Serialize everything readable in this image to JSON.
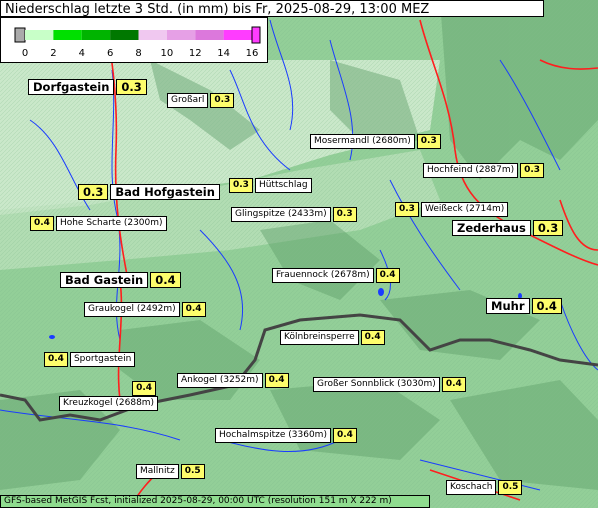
{
  "title": "Niederschlag letzte 3 Std. (in mm) bis Fr, 2025-08-29, 13:00 MEZ",
  "legend": {
    "ticks": [
      "0",
      "2",
      "4",
      "6",
      "8",
      "10",
      "12",
      "14",
      "16"
    ],
    "colors": [
      "#aaaaaa",
      "#c8ffc8",
      "#00e000",
      "#00b400",
      "#007800",
      "#f0c8f0",
      "#e6a0e6",
      "#dc78dc",
      "#ff3cff"
    ]
  },
  "places": [
    {
      "name": "Dorfgastein",
      "value": "0.3",
      "big": true
    },
    {
      "name": "Großarl",
      "value": "0.3"
    },
    {
      "name": "Mosermandl (2680m)",
      "value": "0.3"
    },
    {
      "name": "Hochfeind (2887m)",
      "value": "0.3"
    },
    {
      "name": "Bad Hofgastein",
      "value": "0.3",
      "big": true,
      "valueFirst": true
    },
    {
      "name": "Hüttschlag",
      "value": "0.3",
      "valueFirst": true
    },
    {
      "name": "Weißeck (2714m)",
      "value": "0.3",
      "valueFirst": true
    },
    {
      "name": "Hohe Scharte (2300m)",
      "value": "0.4",
      "valueFirst": true
    },
    {
      "name": "Glingspitze (2433m)",
      "value": "0.3"
    },
    {
      "name": "Zederhaus",
      "value": "0.3",
      "big": true
    },
    {
      "name": "Frauennock (2678m)",
      "value": "0.4"
    },
    {
      "name": "Bad Gastein",
      "value": "0.4",
      "big": true
    },
    {
      "name": "Muhr",
      "value": "0.4",
      "big": true
    },
    {
      "name": "Graukogel (2492m)",
      "value": "0.4"
    },
    {
      "name": "Kölnbreinsperre",
      "value": "0.4"
    },
    {
      "name": "Sportgastein",
      "value": "0.4",
      "valueFirst": true
    },
    {
      "name": "Kreuzkogel (2688m)",
      "value": "0.4",
      "valueAbove": true
    },
    {
      "name": "Ankogel (3252m)",
      "value": "0.4"
    },
    {
      "name": "Großer Sonnblick (3030m)",
      "value": "0.4"
    },
    {
      "name": "Hochalmspitze (3360m)",
      "value": "0.4"
    },
    {
      "name": "Mallnitz",
      "value": "0.5"
    },
    {
      "name": "Koschach",
      "value": "0.5"
    }
  ],
  "footer": "GFS-based MetGIS Fcst, initialized 2025-08-29, 00:00 UTC  (resolution 151 m X 222 m)"
}
